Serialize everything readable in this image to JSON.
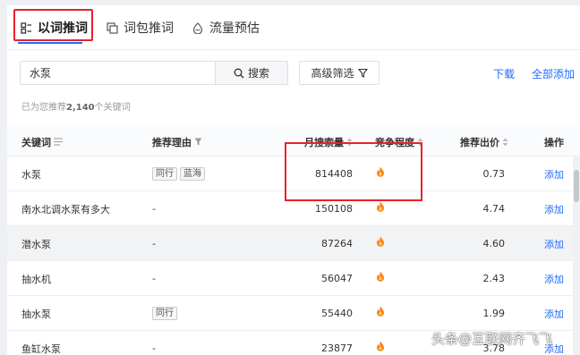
{
  "tabs": [
    {
      "label": "以词推词",
      "icon": "keyword-icon",
      "active": true
    },
    {
      "label": "词包推词",
      "icon": "package-icon",
      "active": false
    },
    {
      "label": "流量预估",
      "icon": "traffic-icon",
      "active": false
    }
  ],
  "search": {
    "value": "水泵",
    "button_label": "搜索"
  },
  "filter": {
    "label": "高级筛选"
  },
  "actions": {
    "download": "下载",
    "add_all": "全部添加"
  },
  "result_count": {
    "prefix": "已为您推荐",
    "count": "2,140",
    "suffix": "个关键词"
  },
  "table": {
    "headers": {
      "keyword": "关键词",
      "reason": "推荐理由",
      "monthly_search": "月搜索量",
      "competition": "竞争程度",
      "suggested_bid": "推荐出价",
      "operation": "操作"
    },
    "rows": [
      {
        "keyword": "水泵",
        "tags": [
          "同行",
          "蓝海"
        ],
        "reason": "",
        "monthly_search": "814408",
        "suggested_bid": "0.73",
        "action": "添加",
        "highlight": false
      },
      {
        "keyword": "南水北调水泵有多大",
        "tags": [],
        "reason": "-",
        "monthly_search": "150108",
        "suggested_bid": "4.74",
        "action": "添加",
        "highlight": false
      },
      {
        "keyword": "潜水泵",
        "tags": [],
        "reason": "-",
        "monthly_search": "87264",
        "suggested_bid": "4.60",
        "action": "添加",
        "highlight": true
      },
      {
        "keyword": "抽水机",
        "tags": [],
        "reason": "-",
        "monthly_search": "56047",
        "suggested_bid": "2.43",
        "action": "添加",
        "highlight": false
      },
      {
        "keyword": "抽水泵",
        "tags": [
          "同行"
        ],
        "reason": "",
        "monthly_search": "55440",
        "suggested_bid": "1.99",
        "action": "添加",
        "highlight": false
      },
      {
        "keyword": "鱼缸水泵",
        "tags": [],
        "reason": "-",
        "monthly_search": "23877",
        "suggested_bid": "3.78",
        "action": "添加",
        "highlight": false
      }
    ]
  },
  "watermark": "头条@互联网齐飞飞",
  "colors": {
    "accent": "#1f6cff",
    "annotation_red": "#e8212b",
    "flame": "#f5831f"
  }
}
